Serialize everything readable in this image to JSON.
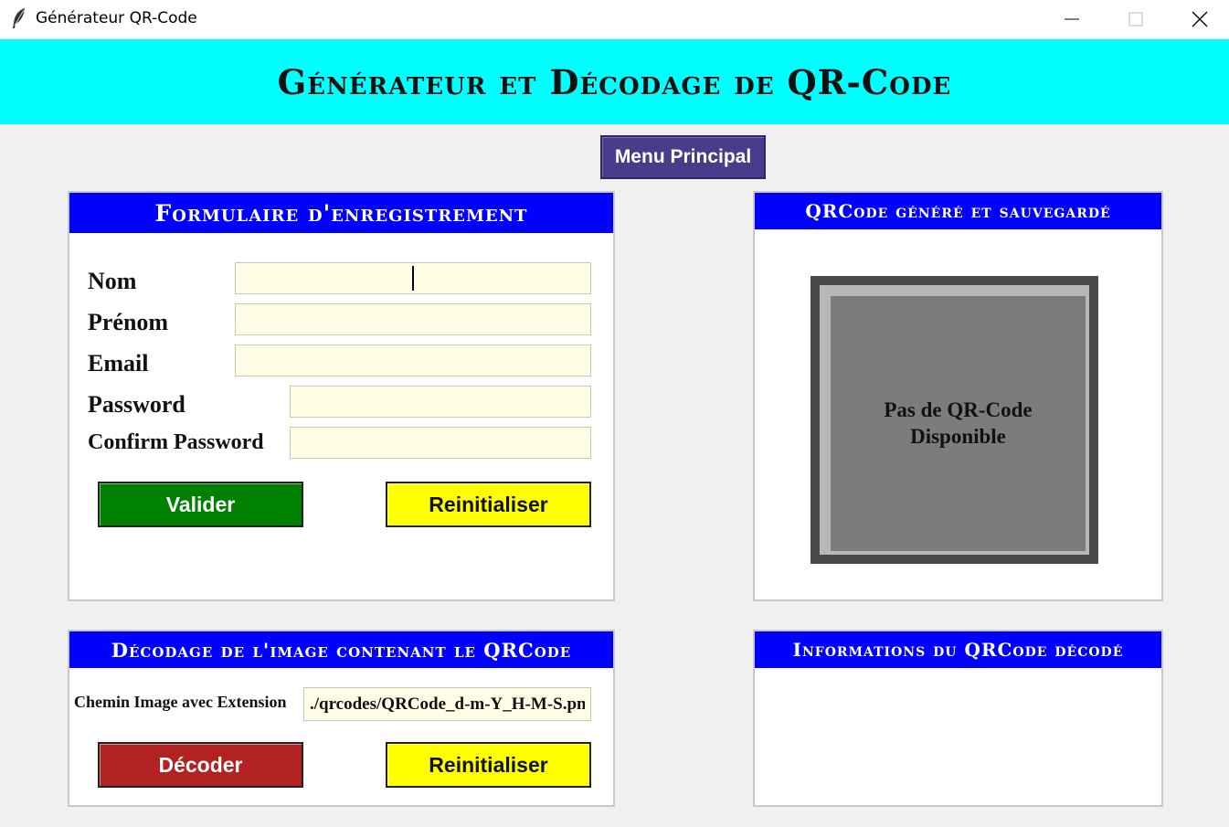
{
  "window": {
    "title": "Générateur QR-Code",
    "controls": {
      "minimize": "minimize-icon",
      "maximize": "maximize-icon",
      "close": "close-icon"
    }
  },
  "header": {
    "title": "Générateur et Décodage de QR-Code",
    "background": "#00ffff"
  },
  "menu_button": {
    "label": "Menu Principal",
    "color": "#483d8b"
  },
  "register_form": {
    "title": "Formulaire d'enregistrement",
    "fields": {
      "nom": {
        "label": "Nom",
        "value": ""
      },
      "prenom": {
        "label": "Prénom",
        "value": ""
      },
      "email": {
        "label": "Email",
        "value": ""
      },
      "password": {
        "label": "Password",
        "value": ""
      },
      "confirm": {
        "label": "Confirm Password",
        "value": ""
      }
    },
    "validate_label": "Valider",
    "reset_label": "Reinitialiser"
  },
  "qr_panel": {
    "title": "QRCode généré et sauvegardé",
    "placeholder_line1": "Pas de QR-Code",
    "placeholder_line2": "Disponible"
  },
  "decode_panel": {
    "title": "Décodage de l'image contenant le QRCode",
    "path_label": "Chemin Image avec Extension",
    "path_value": "./qrcodes/QRCode_d-m-Y_H-M-S.png",
    "decode_label": "Décoder",
    "reset_label": "Reinitialiser"
  },
  "info_panel": {
    "title": "Informations du QRCode décodé",
    "content": ""
  },
  "colors": {
    "panel_header": "#0000ff",
    "valider": "#008000",
    "reinitialiser": "#ffff00",
    "decoder": "#b22222",
    "input_bg": "#fffde6"
  }
}
